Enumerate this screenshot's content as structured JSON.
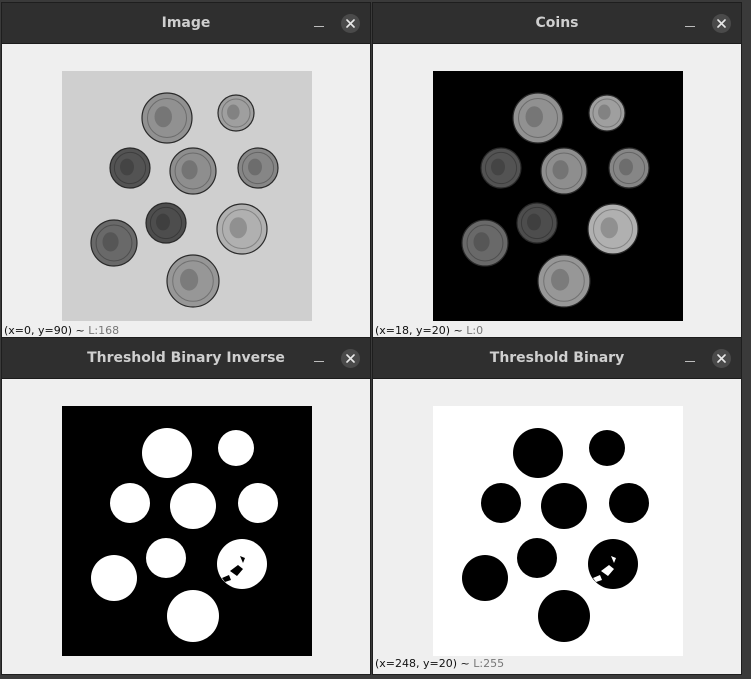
{
  "windows": [
    {
      "title": "Image",
      "status": {
        "coords": "(x=0, y=90)",
        "sep": " ~ ",
        "value": "L:168"
      },
      "kind": "gray"
    },
    {
      "title": "Coins",
      "status": {
        "coords": "(x=18, y=20)",
        "sep": " ~ ",
        "value": "L:0"
      },
      "kind": "masked"
    },
    {
      "title": "Threshold Binary Inverse",
      "status": {
        "coords": "",
        "sep": "",
        "value": ""
      },
      "kind": "inverse"
    },
    {
      "title": "Threshold Binary",
      "status": {
        "coords": "(x=248, y=20)",
        "sep": " ~ ",
        "value": "L:255"
      },
      "kind": "binary"
    }
  ],
  "colors": {
    "titlebar": "#2f2f2f",
    "window_bg": "#efefef",
    "title_text": "#cfcfcf"
  },
  "icons": {
    "minimize": "minimize-icon",
    "close": "close-icon"
  }
}
